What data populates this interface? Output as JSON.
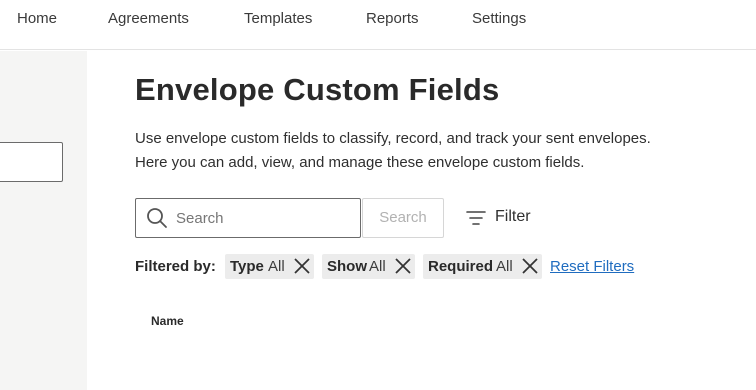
{
  "nav": {
    "items": [
      "Home",
      "Agreements",
      "Templates",
      "Reports",
      "Settings"
    ]
  },
  "page": {
    "title": "Envelope Custom Fields",
    "description_line1": "Use envelope custom fields to classify, record, and track your sent envelopes.",
    "description_line2": "Here you can add, view, and manage these envelope custom fields."
  },
  "search": {
    "placeholder": "Search",
    "button_label": "Search"
  },
  "filter": {
    "button_label": "Filter",
    "filtered_by_label": "Filtered by:",
    "chips": [
      {
        "key": "Type",
        "value": "All"
      },
      {
        "key": "Show",
        "value": "All"
      },
      {
        "key": "Required",
        "value": "All"
      }
    ],
    "reset_label": "Reset Filters"
  },
  "table": {
    "columns": [
      "Name"
    ]
  },
  "colors": {
    "link": "#1f6cbf",
    "chip_bg": "#ececec",
    "sidebar_bg": "#f5f5f4"
  },
  "icons": {
    "search": "search-icon",
    "filter": "filter-icon",
    "chip_close": "close-icon"
  }
}
